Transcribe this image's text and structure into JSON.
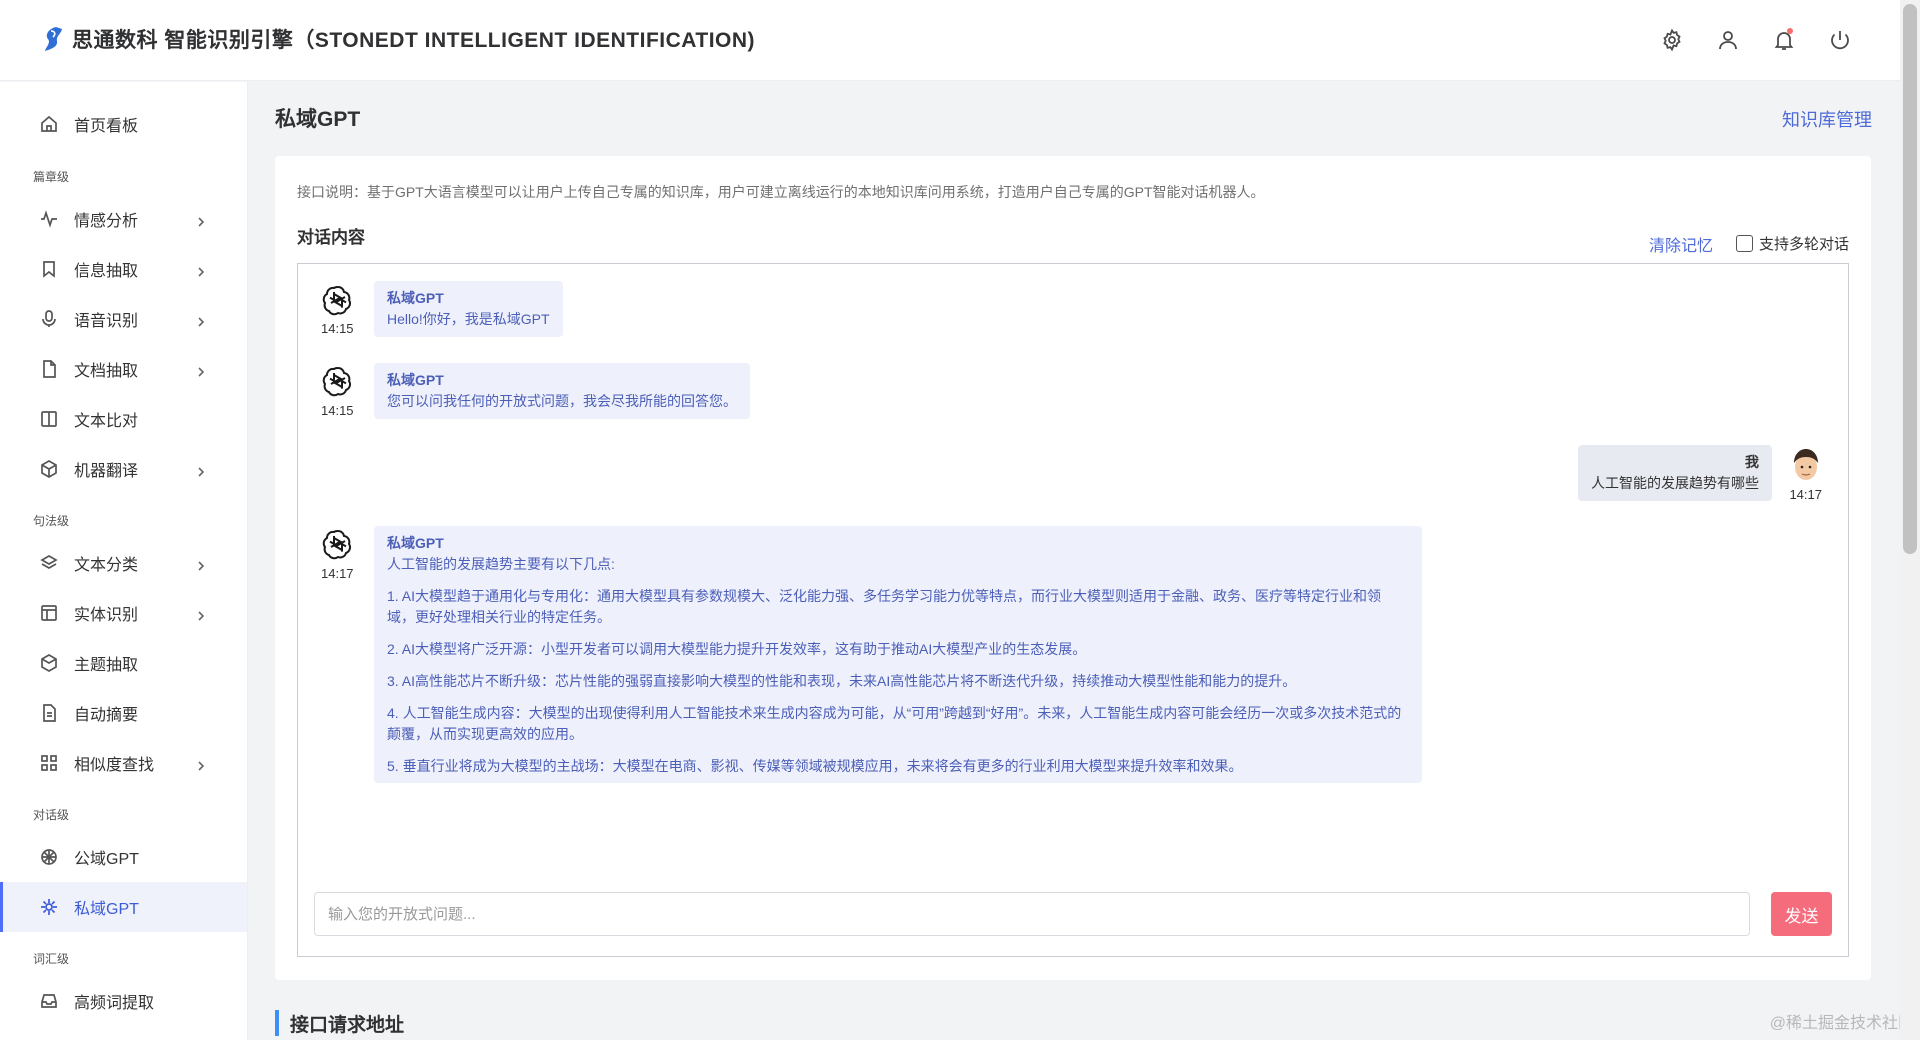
{
  "header": {
    "logo_text": "思通数科 智能识别引擎（STONEDT INTELLIGENT IDENTIFICATION)",
    "icons": [
      "gear-icon",
      "user-icon",
      "bell-icon",
      "power-icon"
    ]
  },
  "sidebar": {
    "items": [
      {
        "label": "首页看板",
        "icon": "home-icon"
      },
      {
        "label": "情感分析",
        "icon": "pulse-icon"
      },
      {
        "label": "信息抽取",
        "icon": "bookmark-icon"
      },
      {
        "label": "语音识别",
        "icon": "microphone-icon"
      },
      {
        "label": "文档抽取",
        "icon": "file-icon"
      },
      {
        "label": "文本比对",
        "icon": "columns-icon"
      },
      {
        "label": "机器翻译",
        "icon": "cube-icon"
      },
      {
        "label": "文本分类",
        "icon": "layers-icon"
      },
      {
        "label": "实体识别",
        "icon": "table-icon"
      },
      {
        "label": "主题抽取",
        "icon": "box-icon"
      },
      {
        "label": "自动摘要",
        "icon": "document-icon"
      },
      {
        "label": "相似度查找",
        "icon": "grid-icon"
      },
      {
        "label": "公域GPT",
        "icon": "openai-icon"
      },
      {
        "label": "私域GPT",
        "icon": "sparkle-icon"
      },
      {
        "label": "高频词提取",
        "icon": "inbox-icon"
      }
    ],
    "groups": [
      "篇章级",
      "句法级",
      "对话级",
      "词汇级"
    ],
    "active": "私域GPT"
  },
  "main": {
    "title": "私域GPT",
    "kb_link": "知识库管理",
    "api_desc": "接口说明：基于GPT大语言模型可以让用户上传自己专属的知识库，用户可建立离线运行的本地知识库问用系统，打造用户自己专属的GPT智能对话机器人。",
    "conv_title": "对话内容",
    "clear_memory": "清除记忆",
    "multi_turn": "支持多轮对话",
    "multi_turn_checked": false,
    "input_placeholder": "输入您的开放式问题...",
    "send_label": "发送",
    "section_title": "接口请求地址",
    "watermark": "@稀土掘金技术社区"
  },
  "chat": [
    {
      "sender": "私域GPT",
      "time": "14:15",
      "text": "Hello!你好，我是私域GPT"
    },
    {
      "sender": "私域GPT",
      "time": "14:15",
      "text": "您可以问我任何的开放式问题，我会尽我所能的回答您。"
    },
    {
      "sender": "我",
      "time": "14:17",
      "text": "人工智能的发展趋势有哪些"
    },
    {
      "sender": "私域GPT",
      "time": "14:17",
      "paragraphs": [
        "人工智能的发展趋势主要有以下几点:",
        "1. AI大模型趋于通用化与专用化：通用大模型具有参数规模大、泛化能力强、多任务学习能力优等特点，而行业大模型则适用于金融、政务、医疗等特定行业和领域，更好处理相关行业的特定任务。",
        "2. AI大模型将广泛开源：小型开发者可以调用大模型能力提升开发效率，这有助于推动AI大模型产业的生态发展。",
        "3. AI高性能芯片不断升级：芯片性能的强弱直接影响大模型的性能和表现，未来AI高性能芯片将不断迭代升级，持续推动大模型性能和能力的提升。",
        "4. 人工智能生成内容：大模型的出现使得利用人工智能技术来生成内容成为可能，从“可用”跨越到“好用”。未来，人工智能生成内容可能会经历一次或多次技术范式的颠覆，从而实现更高效的应用。",
        "5. 垂直行业将成为大模型的主战场：大模型在电商、影视、传媒等领域被规模应用，未来将会有更多的行业利用大模型来提升效率和效果。"
      ]
    }
  ],
  "colors": {
    "accent": "#4e6ad8",
    "send": "#f56c7d",
    "bubble": "#eef0fb",
    "active_bg": "#eff2fb"
  }
}
